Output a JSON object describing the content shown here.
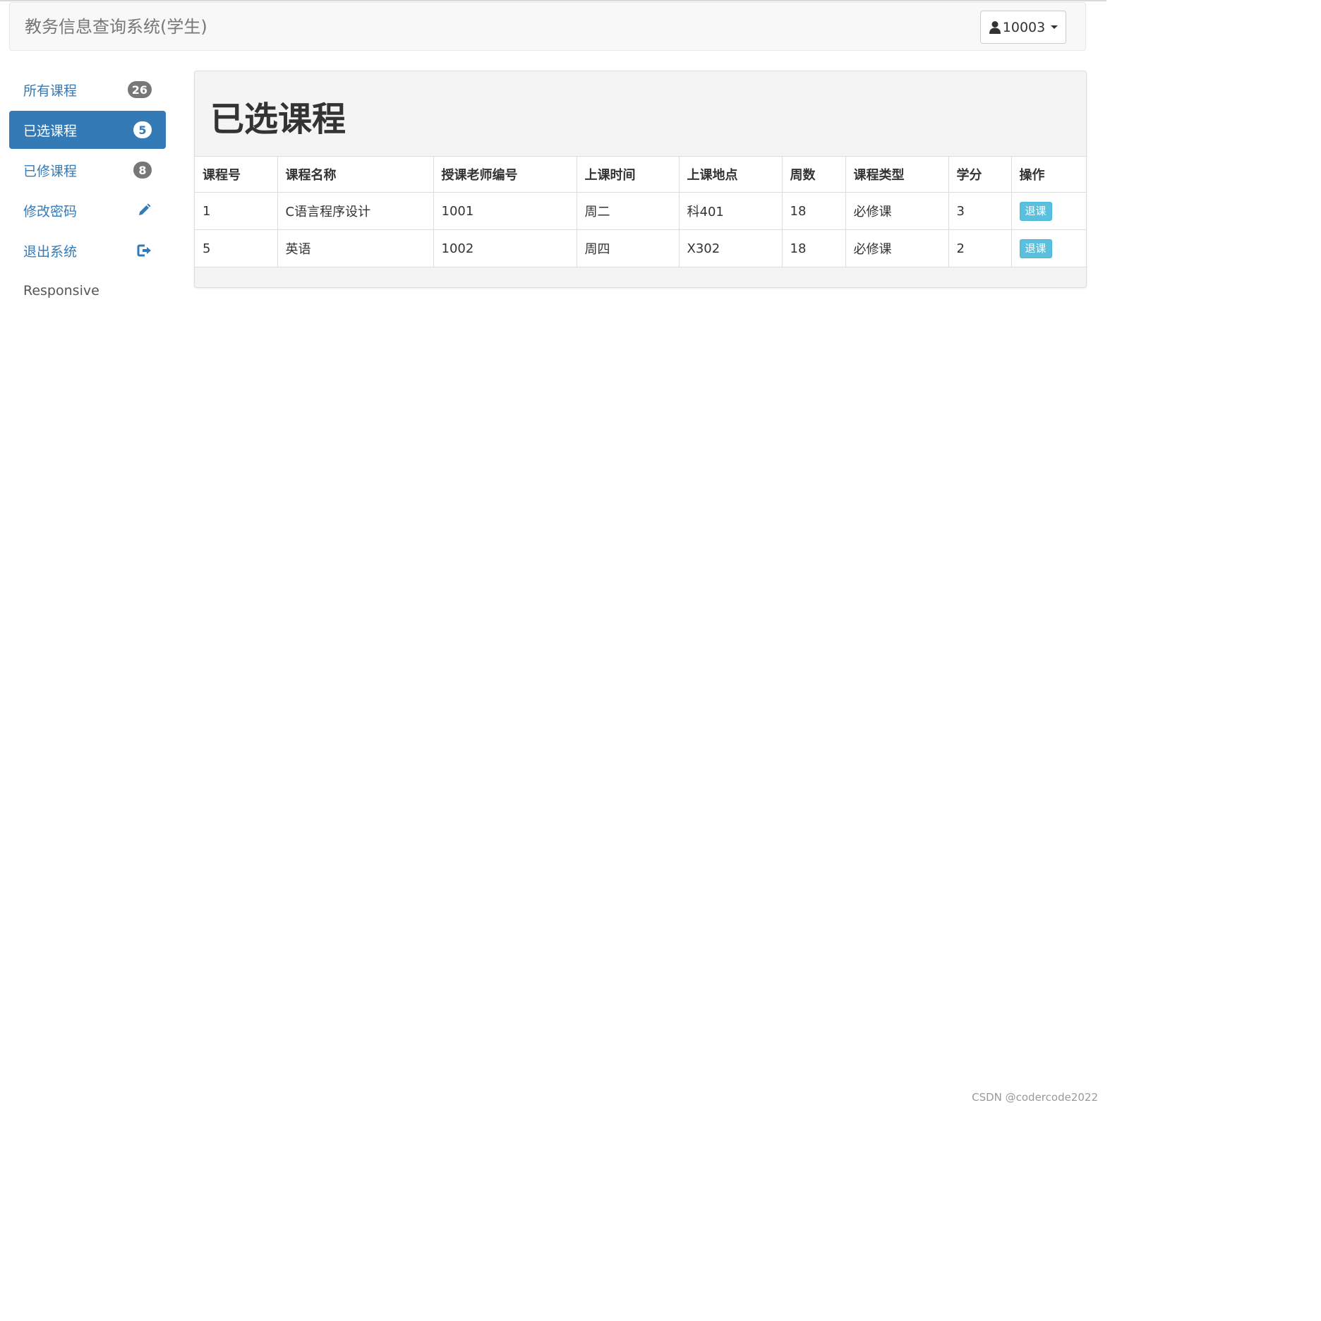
{
  "navbar": {
    "brand": "教务信息查询系统(学生)",
    "user_label": "10003",
    "user_icon": "user-icon"
  },
  "sidebar": {
    "items": [
      {
        "label": "所有课程",
        "badge": "26",
        "active": false
      },
      {
        "label": "已选课程",
        "badge": "5",
        "active": true
      },
      {
        "label": "已修课程",
        "badge": "8",
        "active": false
      },
      {
        "label": "修改密码",
        "icon": "pencil-icon",
        "active": false
      },
      {
        "label": "退出系统",
        "icon": "logout-icon",
        "active": false
      },
      {
        "label": "Responsive",
        "active": false
      }
    ]
  },
  "main": {
    "title": "已选课程",
    "table": {
      "headers": [
        "课程号",
        "课程名称",
        "授课老师编号",
        "上课时间",
        "上课地点",
        "周数",
        "课程类型",
        "学分",
        "操作"
      ],
      "rows": [
        {
          "cells": [
            "1",
            "C语言程序设计",
            "1001",
            "周二",
            "科401",
            "18",
            "必修课",
            "3"
          ],
          "action": "退课"
        },
        {
          "cells": [
            "5",
            "英语",
            "1002",
            "周四",
            "X302",
            "18",
            "必修课",
            "2"
          ],
          "action": "退课"
        }
      ]
    }
  },
  "colors": {
    "primary": "#337ab7",
    "info": "#5bc0de",
    "badge": "#777777",
    "panel_bg": "#f4f4f4"
  },
  "watermark": "CSDN @codercode2022"
}
